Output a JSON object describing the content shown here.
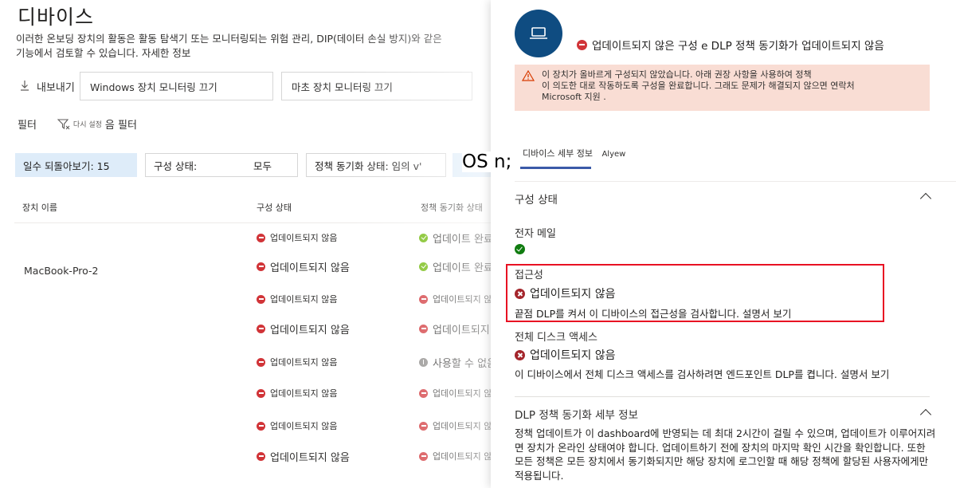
{
  "page": {
    "title": "디바이스",
    "description": "이러한 온보딩 장치의 활동은 활동 탐색기 또는 모니터링되는 위험 관리, DIP(데이터 손실 방지)와 같은 기능에서 검토할 수 있습니다.",
    "learn_more": "자세한 정보"
  },
  "toolbar": {
    "export_label": "내보내기",
    "windows_chip": "Windows 장치 모니터링 끄기",
    "mac_chip": "마초 장치 모니터링 끄기"
  },
  "filters": {
    "filter_label": "필터",
    "reset_label": "다시 설정",
    "filter_suffix": "음 필터",
    "days_pill": "일수 되돌아보기: 15",
    "config_pill_label": "구성 상태:",
    "config_pill_value": "모두",
    "sync_pill": "정책 동기화 상태: 임의 v'",
    "os_overlay": "OS n;"
  },
  "table": {
    "headers": {
      "name": "장치 이름",
      "config": "구성 상태",
      "sync": "정책 동기화 상태"
    },
    "device_name": "MacBook-Pro-2",
    "rows": [
      {
        "config": "업데이트되지 않음",
        "config_size": "small",
        "sync": "업데이트 완료",
        "sync_icon": "green",
        "sync_size": "big"
      },
      {
        "config": "업데이트되지 않음",
        "config_size": "big",
        "sync": "업데이트 완료",
        "sync_icon": "green",
        "sync_size": "big"
      },
      {
        "config": "업데이트되지 않음",
        "config_size": "small",
        "sync": "업데이트되지 않음",
        "sync_icon": "red",
        "sync_size": "small"
      },
      {
        "config": "업데이트되지 않음",
        "config_size": "big",
        "sync": "업데이트되지 않음",
        "sync_icon": "red",
        "sync_size": "big"
      },
      {
        "config": "업데이트되지 않음",
        "config_size": "small",
        "sync": "사용할 수 없음",
        "sync_icon": "grey",
        "sync_size": "big"
      },
      {
        "config": "업데이트되지 않음",
        "config_size": "small",
        "sync": "업데이트되지 않음",
        "sync_icon": "red",
        "sync_size": "small"
      },
      {
        "config": "업데이트되지 않음",
        "config_size": "small",
        "sync": "업데이트되지 않음",
        "sync_icon": "red",
        "sync_size": "small"
      },
      {
        "config": "업데이트되지 않음",
        "config_size": "big",
        "sync": "업데이트되지 않음",
        "sync_icon": "red",
        "sync_size": "small"
      }
    ]
  },
  "panel": {
    "status_text": "업데이트되지 않은 구성 e DLP 정책 동기화가 업데이트되지 않음",
    "warning_line1": "이 장치가 올바르게 구성되지 않았습니다. 아래 권장 사항을 사용하여 정책",
    "warning_line2": "이 의도한 대로 작동하도록 구성을 완료합니다. 그래도 문제가 해결되지 않으면 연락처",
    "warning_line3": "Microsoft 지원 .",
    "tab_details": "디바이스 세부 정보",
    "tab_alerts": "Alyew",
    "config_section": "구성 상태",
    "email_label": "전자 메일",
    "accessibility_label": "접근성",
    "accessibility_status": "업데이트되지 않음",
    "accessibility_note": "끝점 DLP를 켜서 이 디바이스의 접근성을 검사합니다. 설명서 보기",
    "disk_label": "전체 디스크 액세스",
    "disk_status": "업데이트되지 않음",
    "disk_note": "이 디바이스에서 전체 디스크 액세스를 검사하려면 엔드포인트 DLP를 켭니다. 설명서 보기",
    "dlp_section": "DLP 정책 동기화 세부 정보",
    "dlp_text": "정책 업데이트가 이 dashboard에 반영되는 데 최대 2시간이 걸릴 수 있으며, 업데이트가 이루어지려면 장치가 온라인 상태여야 합니다. 업데이트하기 전에 장치의 마지막 확인 시간을 확인합니다. 또한 모든 정책은 모든 장치에서 동기화되지만 해당 장치에 로그인할 때 해당 정책에 할당된 사용자에게만 적용됩니다."
  },
  "colors": {
    "accent": "#0f4c81",
    "error": "#d13438",
    "success": "#107c10",
    "highlight_border": "#e81123",
    "warning_bg": "#f9ddd4"
  },
  "icons": [
    "download-icon",
    "filter-icon",
    "laptop-icon",
    "warning-icon",
    "chevron-up-icon",
    "status-error-icon",
    "status-ok-icon",
    "status-unavailable-icon"
  ]
}
